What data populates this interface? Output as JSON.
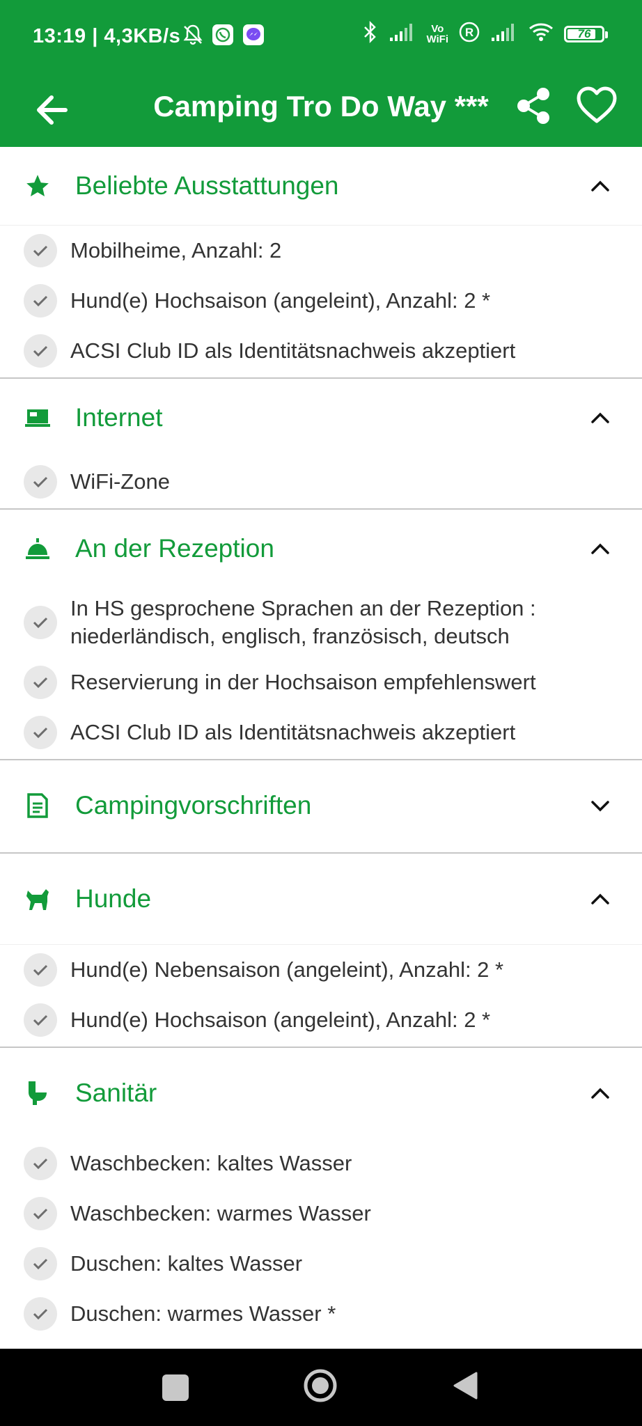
{
  "status_bar": {
    "time_speed": "13:19 | 4,3KB/s",
    "vowifi_line1": "Vo",
    "vowifi_line2": "WiFi",
    "battery_percent": "76",
    "icons": [
      "bell-off-icon",
      "whatsapp-icon",
      "messenger-icon",
      "bluetooth-icon",
      "signal-icon",
      "vowifi-icon",
      "roaming-icon",
      "signal-icon",
      "wifi-icon",
      "battery-icon"
    ]
  },
  "app_bar": {
    "title": "Camping Tro Do Way ***",
    "icons": [
      "arrow-left-icon",
      "share-icon",
      "heart-icon"
    ]
  },
  "colors": {
    "primary": "#129b3a",
    "text": "#333333",
    "check_bg": "#e8e8e8"
  },
  "sections": [
    {
      "title": "Beliebte Ausstattungen",
      "icon": "star-icon",
      "expanded": true,
      "items": [
        "Mobilheime, Anzahl: 2",
        "Hund(e) Hochsaison (angeleint), Anzahl: 2 *",
        "ACSI Club ID als Identitätsnachweis akzeptiert"
      ]
    },
    {
      "title": "Internet",
      "icon": "laptop-icon",
      "expanded": true,
      "items": [
        "WiFi-Zone"
      ]
    },
    {
      "title": "An der Rezeption",
      "icon": "reception-bell-icon",
      "expanded": true,
      "items": [
        "In HS gesprochene Sprachen an der Rezeption : niederländisch, englisch, französisch, deutsch",
        "Reservierung in der Hochsaison empfehlenswert",
        "ACSI Club ID als Identitätsnachweis akzeptiert"
      ]
    },
    {
      "title": "Campingvorschriften",
      "icon": "document-icon",
      "expanded": false,
      "items": []
    },
    {
      "title": "Hunde",
      "icon": "dog-icon",
      "expanded": true,
      "items": [
        "Hund(e) Nebensaison (angeleint), Anzahl: 2 *",
        "Hund(e) Hochsaison (angeleint), Anzahl: 2 *"
      ]
    },
    {
      "title": "Sanitär",
      "icon": "toilet-icon",
      "expanded": true,
      "items": [
        "Waschbecken: kaltes Wasser",
        "Waschbecken: warmes Wasser",
        "Duschen: kaltes Wasser",
        "Duschen: warmes Wasser *"
      ]
    }
  ],
  "nav_bar": {
    "icons": [
      "recents-square-icon",
      "home-circle-icon",
      "back-triangle-icon"
    ]
  }
}
